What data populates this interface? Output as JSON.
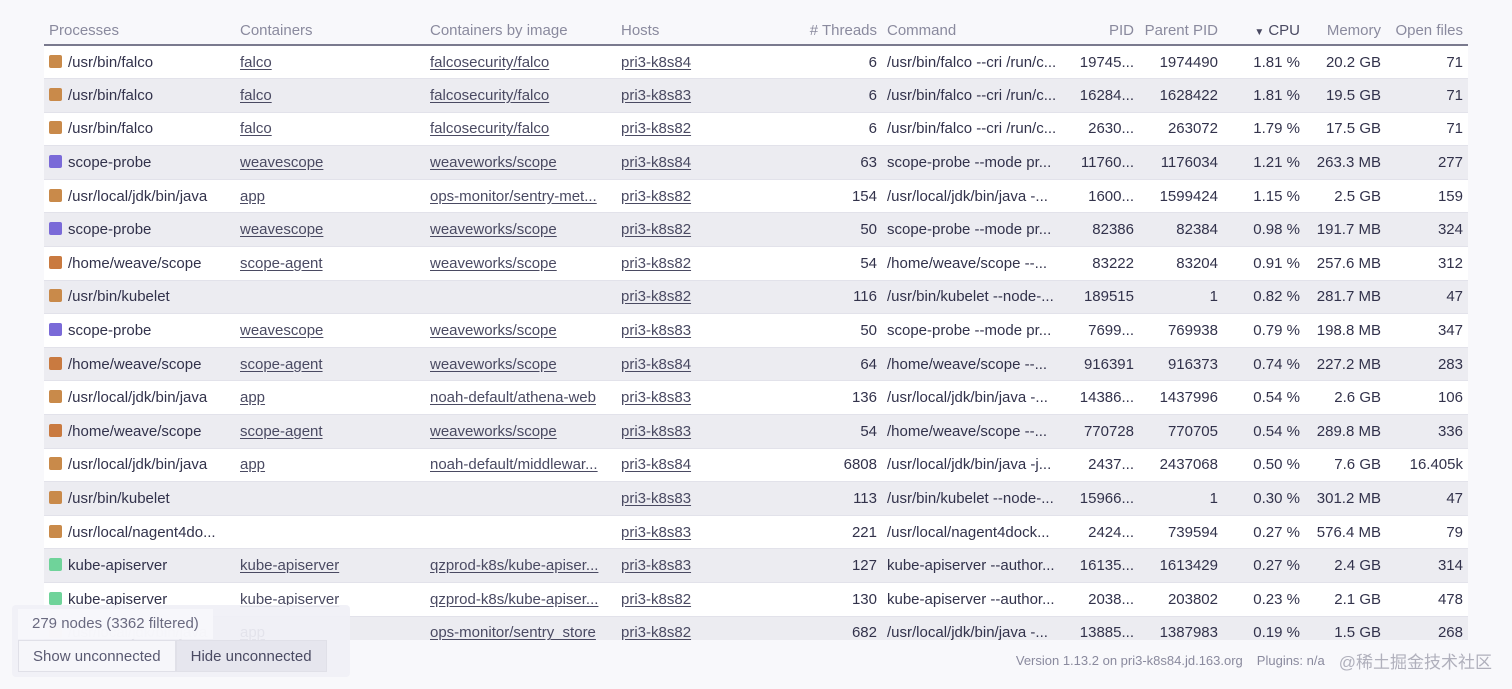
{
  "table": {
    "columns": {
      "processes": "Processes",
      "containers": "Containers",
      "containers_by_image": "Containers by image",
      "hosts": "Hosts",
      "threads": "# Threads",
      "command": "Command",
      "pid": "PID",
      "parent_pid": "Parent PID",
      "cpu": "CPU",
      "memory": "Memory",
      "open_files": "Open files"
    },
    "sorted_column": "cpu",
    "rows": [
      {
        "color": "#c98a4a",
        "process": "/usr/bin/falco",
        "container": "falco",
        "image": "falcosecurity/falco",
        "host": "pri3-k8s84",
        "threads": "6",
        "command": "/usr/bin/falco --cri /run/c...",
        "pid": "19745...",
        "ppid": "1974490",
        "cpu": "1.81 %",
        "memory": "20.2 GB",
        "files": "71"
      },
      {
        "color": "#c98a4a",
        "process": "/usr/bin/falco",
        "container": "falco",
        "image": "falcosecurity/falco",
        "host": "pri3-k8s83",
        "threads": "6",
        "command": "/usr/bin/falco --cri /run/c...",
        "pid": "16284...",
        "ppid": "1628422",
        "cpu": "1.81 %",
        "memory": "19.5 GB",
        "files": "71"
      },
      {
        "color": "#c98a4a",
        "process": "/usr/bin/falco",
        "container": "falco",
        "image": "falcosecurity/falco",
        "host": "pri3-k8s82",
        "threads": "6",
        "command": "/usr/bin/falco --cri /run/c...",
        "pid": "2630...",
        "ppid": "263072",
        "cpu": "1.79 %",
        "memory": "17.5 GB",
        "files": "71"
      },
      {
        "color": "#7a6ad8",
        "process": "scope-probe",
        "container": "weavescope",
        "image": "weaveworks/scope",
        "host": "pri3-k8s84",
        "threads": "63",
        "command": "scope-probe --mode pr...",
        "pid": "11760...",
        "ppid": "1176034",
        "cpu": "1.21 %",
        "memory": "263.3 MB",
        "files": "277"
      },
      {
        "color": "#c98a4a",
        "process": "/usr/local/jdk/bin/java",
        "container": "app",
        "image": "ops-monitor/sentry-met...",
        "host": "pri3-k8s82",
        "threads": "154",
        "command": "/usr/local/jdk/bin/java -...",
        "pid": "1600...",
        "ppid": "1599424",
        "cpu": "1.15 %",
        "memory": "2.5 GB",
        "files": "159"
      },
      {
        "color": "#7a6ad8",
        "process": "scope-probe",
        "container": "weavescope",
        "image": "weaveworks/scope",
        "host": "pri3-k8s82",
        "threads": "50",
        "command": "scope-probe --mode pr...",
        "pid": "82386",
        "ppid": "82384",
        "cpu": "0.98 %",
        "memory": "191.7 MB",
        "files": "324"
      },
      {
        "color": "#c97a40",
        "process": "/home/weave/scope",
        "container": "scope-agent",
        "image": "weaveworks/scope",
        "host": "pri3-k8s82",
        "threads": "54",
        "command": "/home/weave/scope --...",
        "pid": "83222",
        "ppid": "83204",
        "cpu": "0.91 %",
        "memory": "257.6 MB",
        "files": "312"
      },
      {
        "color": "#c98a4a",
        "process": "/usr/bin/kubelet",
        "container": "",
        "image": "",
        "host": "pri3-k8s82",
        "threads": "116",
        "command": "/usr/bin/kubelet --node-...",
        "pid": "189515",
        "ppid": "1",
        "cpu": "0.82 %",
        "memory": "281.7 MB",
        "files": "47"
      },
      {
        "color": "#7a6ad8",
        "process": "scope-probe",
        "container": "weavescope",
        "image": "weaveworks/scope",
        "host": "pri3-k8s83",
        "threads": "50",
        "command": "scope-probe --mode pr...",
        "pid": "7699...",
        "ppid": "769938",
        "cpu": "0.79 %",
        "memory": "198.8 MB",
        "files": "347"
      },
      {
        "color": "#c97a40",
        "process": "/home/weave/scope",
        "container": "scope-agent",
        "image": "weaveworks/scope",
        "host": "pri3-k8s84",
        "threads": "64",
        "command": "/home/weave/scope --...",
        "pid": "916391",
        "ppid": "916373",
        "cpu": "0.74 %",
        "memory": "227.2 MB",
        "files": "283"
      },
      {
        "color": "#c98a4a",
        "process": "/usr/local/jdk/bin/java",
        "container": "app",
        "image": "noah-default/athena-web",
        "host": "pri3-k8s83",
        "threads": "136",
        "command": "/usr/local/jdk/bin/java -...",
        "pid": "14386...",
        "ppid": "1437996",
        "cpu": "0.54 %",
        "memory": "2.6 GB",
        "files": "106"
      },
      {
        "color": "#c97a40",
        "process": "/home/weave/scope",
        "container": "scope-agent",
        "image": "weaveworks/scope",
        "host": "pri3-k8s83",
        "threads": "54",
        "command": "/home/weave/scope --...",
        "pid": "770728",
        "ppid": "770705",
        "cpu": "0.54 %",
        "memory": "289.8 MB",
        "files": "336"
      },
      {
        "color": "#c98a4a",
        "process": "/usr/local/jdk/bin/java",
        "container": "app",
        "image": "noah-default/middlewar...",
        "host": "pri3-k8s84",
        "threads": "6808",
        "command": "/usr/local/jdk/bin/java -j...",
        "pid": "2437...",
        "ppid": "2437068",
        "cpu": "0.50 %",
        "memory": "7.6 GB",
        "files": "16.405k"
      },
      {
        "color": "#c98a4a",
        "process": "/usr/bin/kubelet",
        "container": "",
        "image": "",
        "host": "pri3-k8s83",
        "threads": "113",
        "command": "/usr/bin/kubelet --node-...",
        "pid": "15966...",
        "ppid": "1",
        "cpu": "0.30 %",
        "memory": "301.2 MB",
        "files": "47"
      },
      {
        "color": "#c98a4a",
        "process": "/usr/local/nagent4do...",
        "container": "",
        "image": "",
        "host": "pri3-k8s83",
        "threads": "221",
        "command": "/usr/local/nagent4dock...",
        "pid": "2424...",
        "ppid": "739594",
        "cpu": "0.27 %",
        "memory": "576.4 MB",
        "files": "79"
      },
      {
        "color": "#6fd39a",
        "process": "kube-apiserver",
        "container": "kube-apiserver",
        "image": "qzprod-k8s/kube-apiser...",
        "host": "pri3-k8s83",
        "threads": "127",
        "command": "kube-apiserver --author...",
        "pid": "16135...",
        "ppid": "1613429",
        "cpu": "0.27 %",
        "memory": "2.4 GB",
        "files": "314"
      },
      {
        "color": "#6fd39a",
        "process": "kube-apiserver",
        "container": "kube-apiserver",
        "image": "qzprod-k8s/kube-apiser...",
        "host": "pri3-k8s82",
        "threads": "130",
        "command": "kube-apiserver --author...",
        "pid": "2038...",
        "ppid": "203802",
        "cpu": "0.23 %",
        "memory": "2.1 GB",
        "files": "478"
      },
      {
        "color": "#c98a4a",
        "process": "/usr/local/jdk/bin/java",
        "container": "app",
        "image": "ops-monitor/sentry_store",
        "host": "pri3-k8s82",
        "threads": "682",
        "command": "/usr/local/jdk/bin/java -...",
        "pid": "13885...",
        "ppid": "1387983",
        "cpu": "0.19 %",
        "memory": "1.5 GB",
        "files": "268"
      }
    ]
  },
  "footer": {
    "node_count": "279 nodes (3362 filtered)",
    "show_unconnected": "Show unconnected",
    "hide_unconnected": "Hide unconnected",
    "version": "Version 1.13.2 on pri3-k8s84.jd.163.org",
    "plugins": "Plugins: n/a",
    "watermark": "@稀土掘金技术社区"
  }
}
